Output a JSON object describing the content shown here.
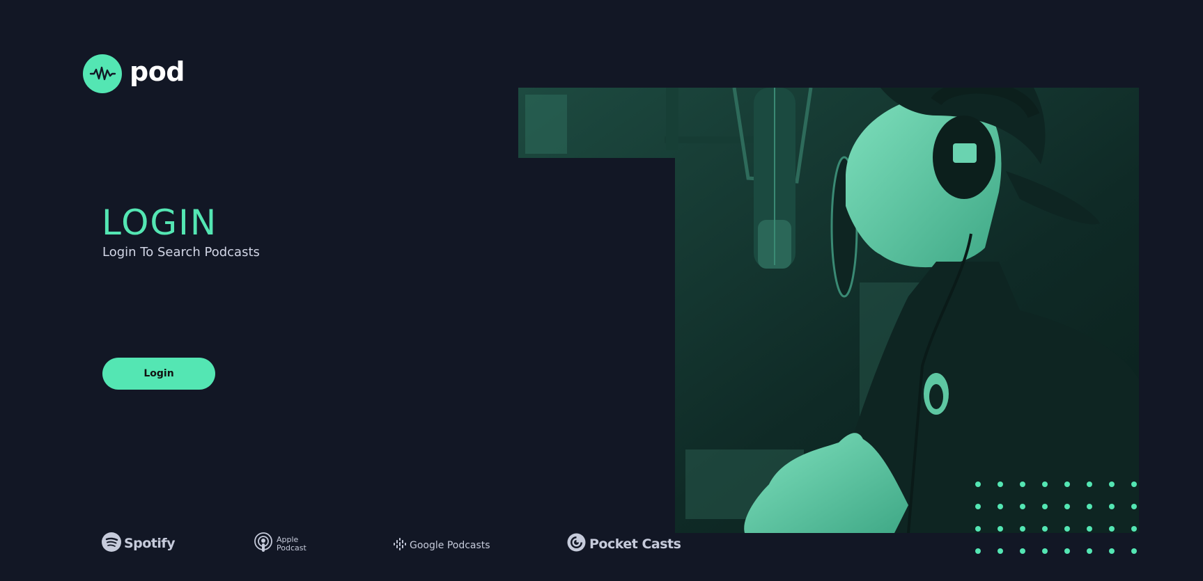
{
  "brand": {
    "name": "pod",
    "logo_icon": "waveform-icon",
    "accent_color": "#54e6b3",
    "background_color": "#121725"
  },
  "hero": {
    "title": "LOGIN",
    "subtitle": "Login To Search Podcasts",
    "button_label": "Login",
    "image": "podcaster-at-microphone-photo"
  },
  "platforms": [
    {
      "name": "Spotify",
      "icon": "spotify-icon"
    },
    {
      "name_line1": "Apple",
      "name_line2": "Podcast",
      "icon": "apple-podcast-icon"
    },
    {
      "name": "Google Podcasts",
      "icon": "google-podcasts-icon"
    },
    {
      "name": "Pocket Casts",
      "icon": "pocket-casts-icon"
    }
  ]
}
